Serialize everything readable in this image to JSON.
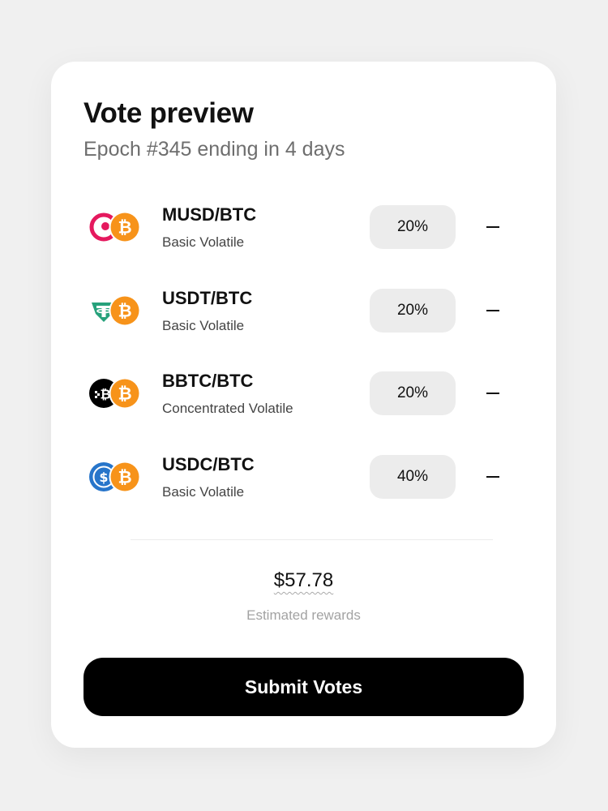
{
  "header": {
    "title": "Vote preview",
    "subtitle": "Epoch #345 ending in 4 days"
  },
  "pairs": [
    {
      "name": "MUSD/BTC",
      "type": "Basic Volatile",
      "percent": "20%",
      "base_icon": "musd-icon",
      "quote_icon": "bitcoin-icon"
    },
    {
      "name": "USDT/BTC",
      "type": "Basic Volatile",
      "percent": "20%",
      "base_icon": "usdt-icon",
      "quote_icon": "bitcoin-icon"
    },
    {
      "name": "BBTC/BTC",
      "type": "Concentrated Volatile",
      "percent": "20%",
      "base_icon": "bbtc-icon",
      "quote_icon": "bitcoin-icon"
    },
    {
      "name": "USDC/BTC",
      "type": "Basic Volatile",
      "percent": "40%",
      "base_icon": "usdc-icon",
      "quote_icon": "bitcoin-icon"
    }
  ],
  "rewards": {
    "amount": "$57.78",
    "label": "Estimated rewards"
  },
  "submit": {
    "label": "Submit Votes"
  },
  "colors": {
    "bitcoin": "#f7931a",
    "musd": "#e5195e",
    "usdt": "#26a17b",
    "bbtc": "#000000",
    "usdc": "#2775ca",
    "field_bg": "#ececec",
    "button_bg": "#000000"
  }
}
